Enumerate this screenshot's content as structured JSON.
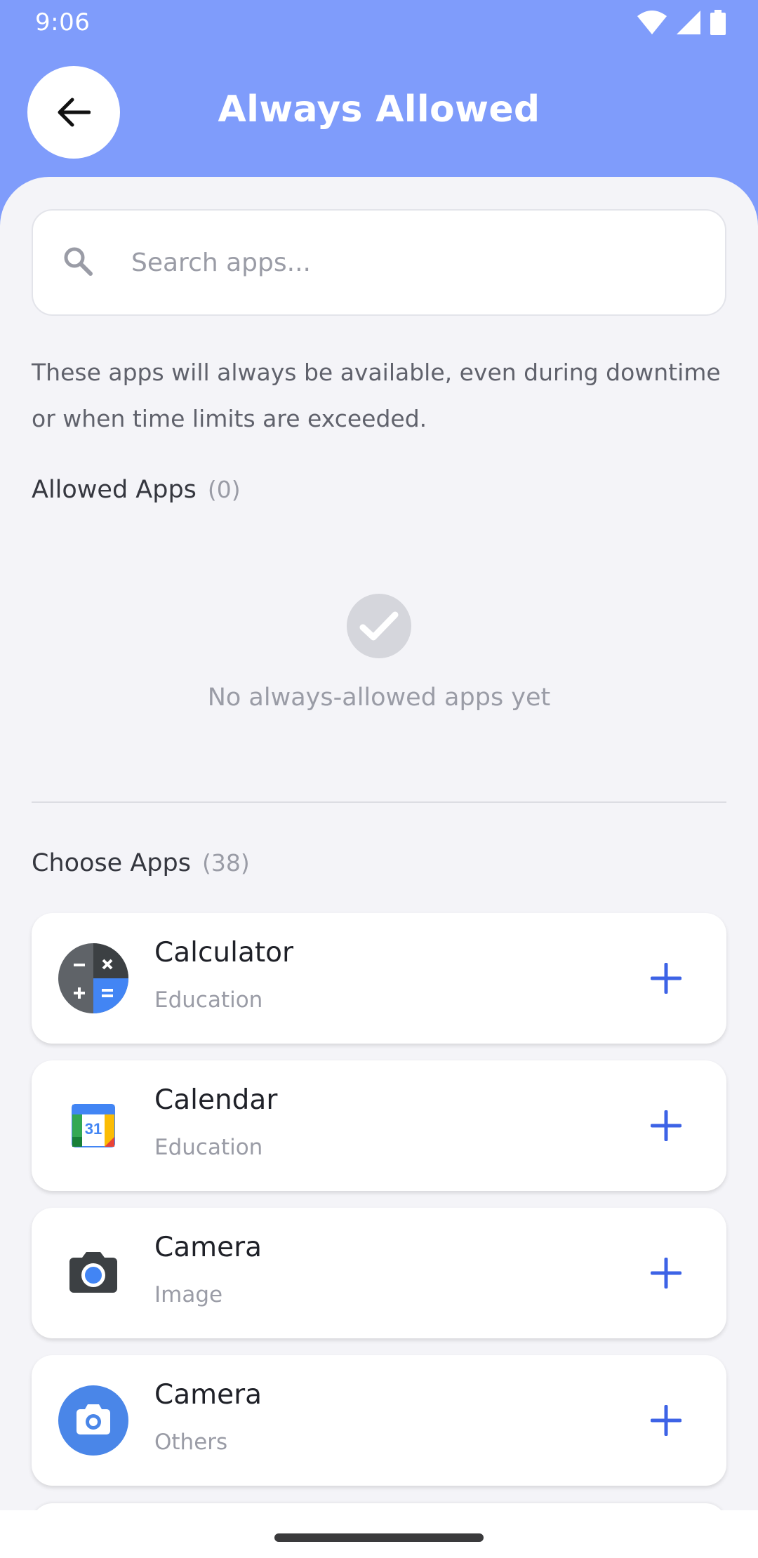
{
  "status_bar": {
    "time": "9:06"
  },
  "header": {
    "title": "Always Allowed"
  },
  "search": {
    "placeholder": "Search apps..."
  },
  "description": "These apps will always be available, even during downtime or when time limits are exceeded.",
  "allowed_section": {
    "title": "Allowed Apps",
    "count": "(0)",
    "empty_text": "No always-allowed apps yet"
  },
  "choose_section": {
    "title": "Choose Apps",
    "count": "(38)"
  },
  "apps": [
    {
      "name": "Calculator",
      "category": "Education",
      "icon": "calculator-icon"
    },
    {
      "name": "Calendar",
      "category": "Education",
      "icon": "calendar-icon"
    },
    {
      "name": "Camera",
      "category": "Image",
      "icon": "camera-icon"
    },
    {
      "name": "Camera",
      "category": "Others",
      "icon": "camera-blue-icon"
    }
  ],
  "calendar_icon_day": "31",
  "colors": {
    "accent": "#7f9cfb",
    "add": "#3d63e6",
    "background": "#f4f4f8"
  }
}
